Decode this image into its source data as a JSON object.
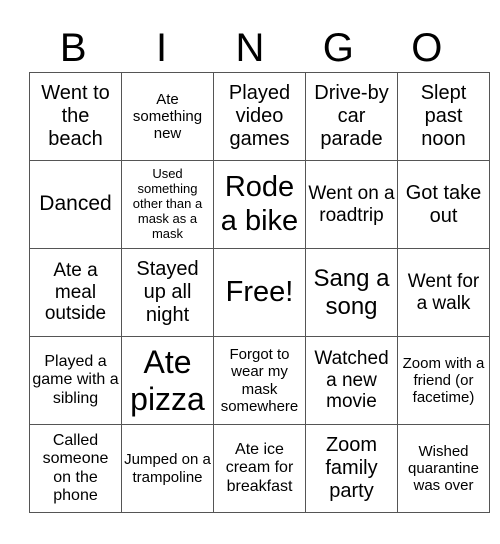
{
  "header": {
    "letters": [
      "B",
      "I",
      "N",
      "G",
      "O"
    ]
  },
  "grid": {
    "rows": [
      [
        "Went to the beach",
        "Ate something new",
        "Played video games",
        "Drive-by car parade",
        "Slept past noon"
      ],
      [
        "Danced",
        "Used something other than a mask as a mask",
        "Rode a bike",
        "Went on a roadtrip",
        "Got take out"
      ],
      [
        "Ate a meal outside",
        "Stayed up all night",
        "Free!",
        "Sang a song",
        "Went for a walk"
      ],
      [
        "Played a game with a sibling",
        "Ate pizza",
        "Forgot to wear my mask somewhere",
        "Watched a new movie",
        "Zoom with a friend (or facetime)"
      ],
      [
        "Called someone on the phone",
        "Jumped on a trampoline",
        "Ate ice cream for breakfast",
        "Zoom family party",
        "Wished quarantine was over"
      ]
    ]
  }
}
